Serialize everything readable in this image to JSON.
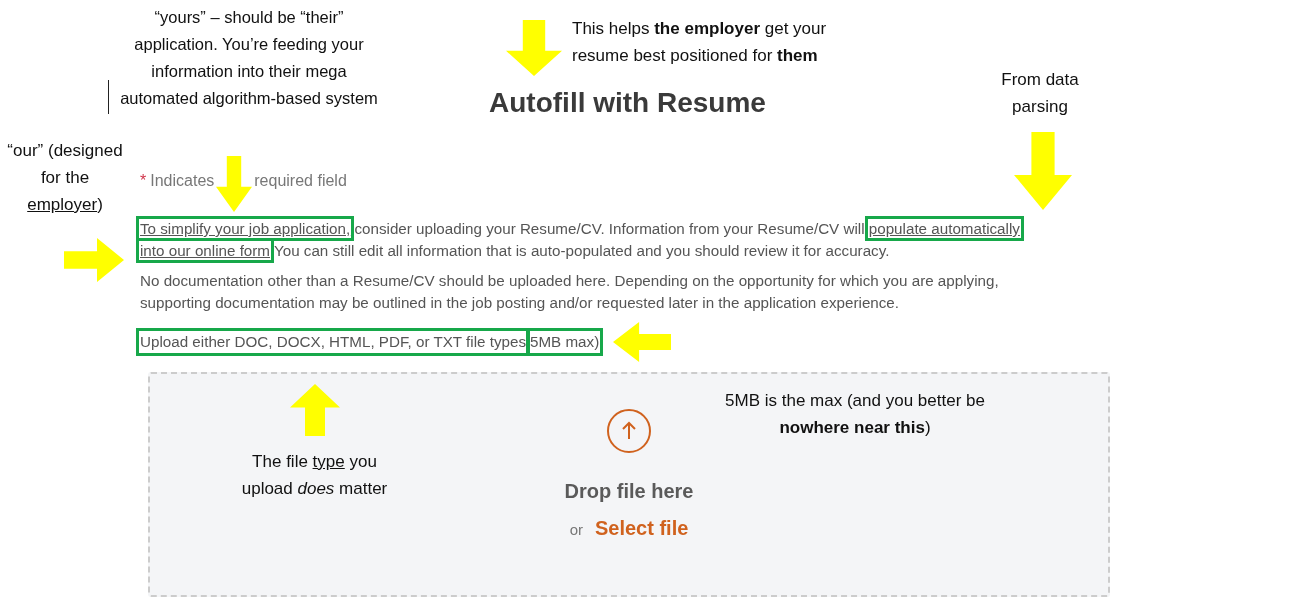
{
  "form": {
    "title": "Autofill with Resume",
    "required_note": {
      "mark": "*",
      "before": "Indicates",
      "after": "required field"
    },
    "intro": [
      [
        {
          "text": "To simplify your job application,",
          "highlighted": true
        },
        {
          "text": " consider uploading your Resume/CV. Information from your Resume/CV will ",
          "highlighted": false
        },
        {
          "text": "populate automatically",
          "highlighted": true
        }
      ],
      [
        {
          "text": "into our online form",
          "highlighted": true
        },
        {
          "text": " You can still edit all information that is auto-populated and you should review it for accuracy.",
          "highlighted": false
        }
      ]
    ],
    "notice": [
      "No documentation other than a Resume/CV should be uploaded here. Depending on the opportunity for which you are applying,",
      "supporting documentation may be outlined in the job posting and/or requested later in the application experience."
    ],
    "file_rules": [
      {
        "text": "Upload either DOC, DOCX, HTML, PDF, or TXT file types",
        "highlighted": true
      },
      {
        "text": "5MB max)",
        "highlighted": true
      }
    ],
    "dropzone": {
      "prompt": "Drop file here",
      "or": "or",
      "link": "Select file"
    }
  },
  "annotations": [
    {
      "parts": [
        {
          "text": "“yours” – should be “their” application. You’re feeding your information into their mega automated algorithm-based system",
          "kind": "plain"
        }
      ]
    },
    {
      "parts": [
        {
          "text": "“our” (designed for the ",
          "kind": "plain"
        },
        {
          "text": "employer",
          "kind": "underline"
        },
        {
          "text": ")",
          "kind": "plain"
        }
      ]
    },
    {
      "parts": [
        {
          "text": "This helps ",
          "kind": "plain"
        },
        {
          "text": "the employer",
          "kind": "bold"
        },
        {
          "text": " get your resume best positioned for ",
          "kind": "plain"
        },
        {
          "text": "them",
          "kind": "bold"
        }
      ]
    },
    {
      "parts": [
        {
          "text": "From data parsing",
          "kind": "plain"
        }
      ]
    },
    {
      "parts": [
        {
          "text": "5MB is the max (and you better be ",
          "kind": "plain"
        },
        {
          "text": "nowhere near this",
          "kind": "bold"
        },
        {
          "text": ")",
          "kind": "plain"
        }
      ]
    },
    {
      "parts": [
        {
          "text": "The file ",
          "kind": "plain"
        },
        {
          "text": "type",
          "kind": "underline"
        },
        {
          "text": " you upload ",
          "kind": "plain"
        },
        {
          "text": "does",
          "kind": "italic"
        },
        {
          "text": " matter",
          "kind": "plain"
        }
      ]
    }
  ]
}
